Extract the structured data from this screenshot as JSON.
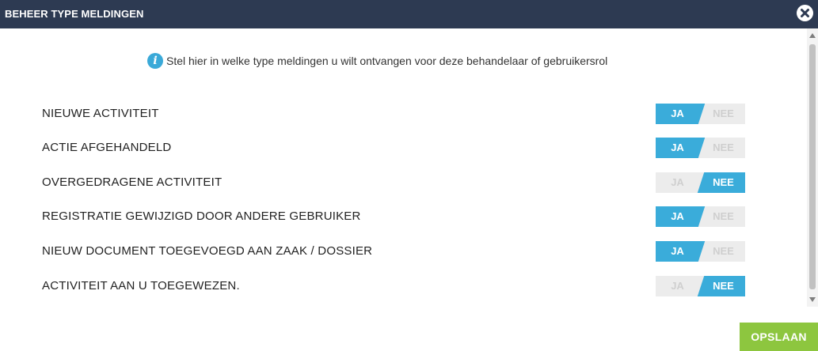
{
  "dialog": {
    "title": "BEHEER TYPE MELDINGEN",
    "close_icon": "close-circle-icon"
  },
  "info": {
    "icon": "info-icon",
    "icon_glyph": "i",
    "text": "Stel hier in welke type meldingen u wilt ontvangen voor deze behandelaar of gebruikersrol"
  },
  "toggle_labels": {
    "on": "JA",
    "off": "NEE"
  },
  "notifications": [
    {
      "label": "NIEUWE ACTIVITEIT",
      "selected": "JA"
    },
    {
      "label": "ACTIE AFGEHANDELD",
      "selected": "JA"
    },
    {
      "label": "OVERGEDRAGENE ACTIVITEIT",
      "selected": "NEE"
    },
    {
      "label": "REGISTRATIE GEWIJZIGD DOOR ANDERE GEBRUIKER",
      "selected": "JA"
    },
    {
      "label": "NIEUW DOCUMENT TOEGEVOEGD AAN ZAAK / DOSSIER",
      "selected": "JA"
    },
    {
      "label": "ACTIVITEIT AAN U TOEGEWEZEN.",
      "selected": "NEE"
    }
  ],
  "save_label": "OPSLAAN",
  "colors": {
    "titlebar": "#2d3a52",
    "toggle_active": "#3aacda",
    "toggle_inactive": "#ececec",
    "save_button": "#8dc63f"
  }
}
